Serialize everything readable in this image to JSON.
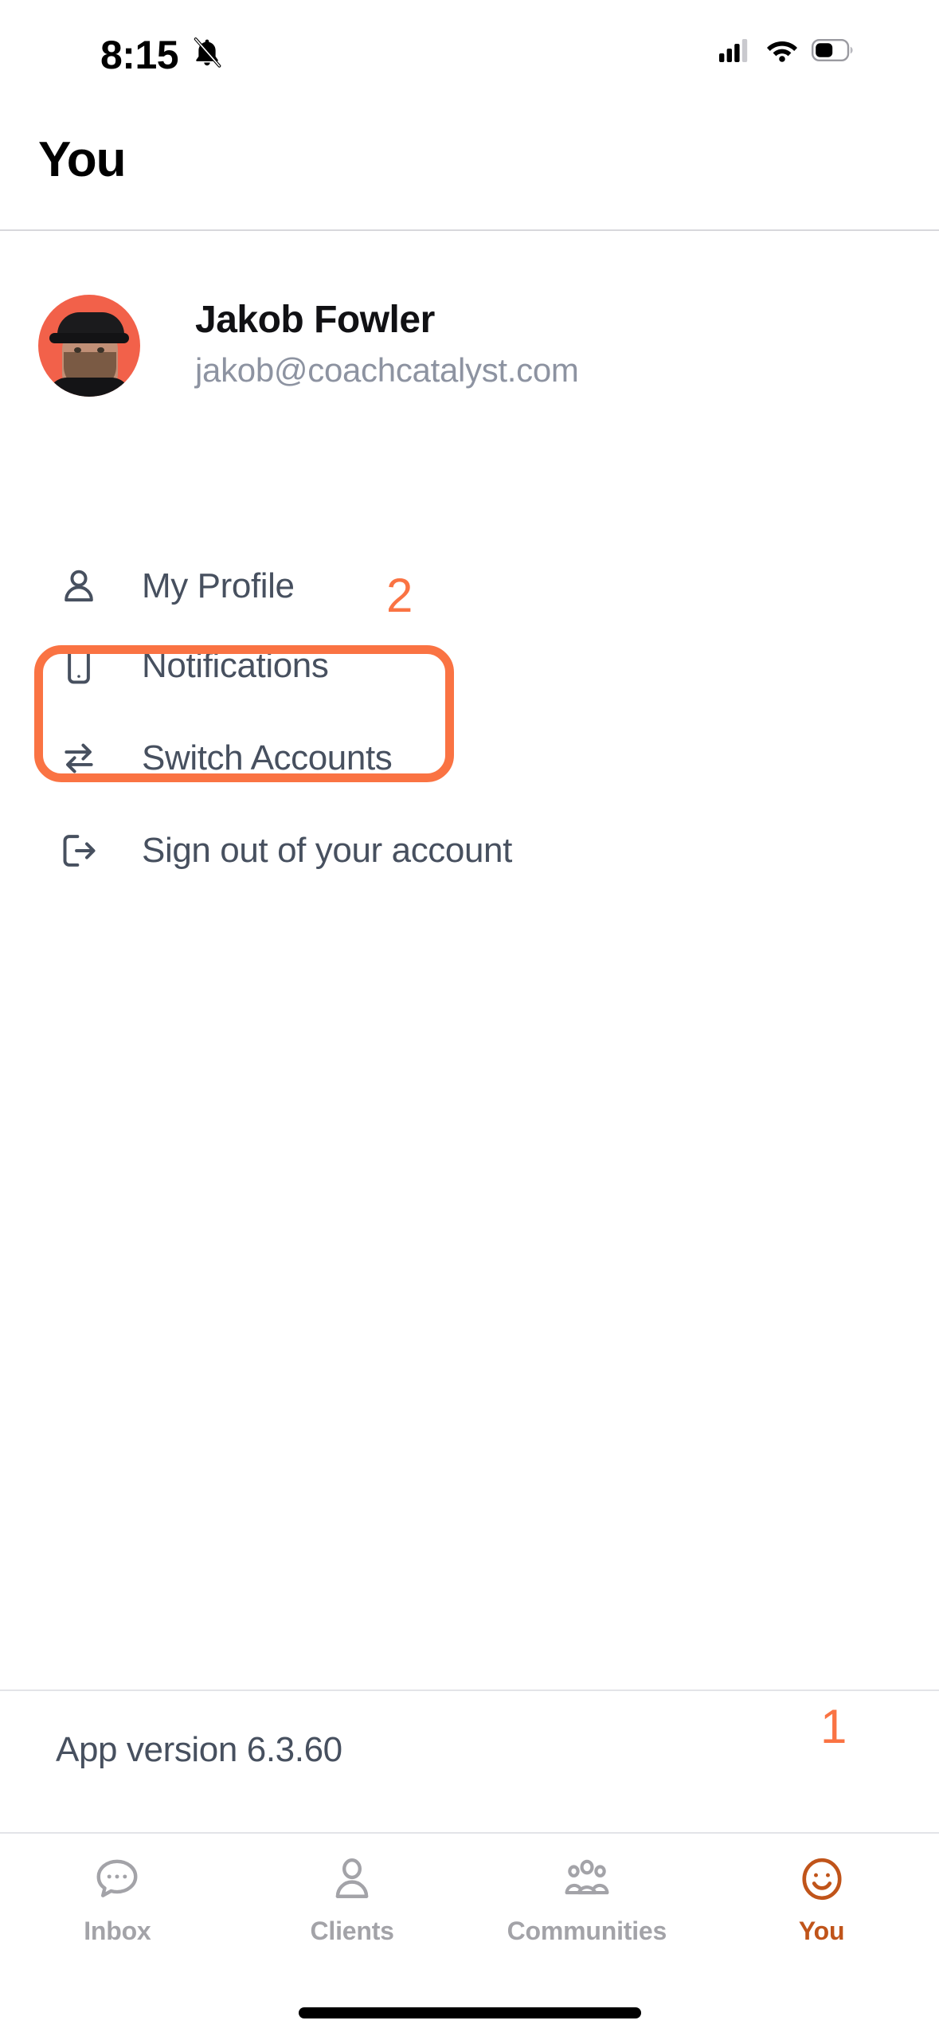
{
  "status_bar": {
    "time": "8:15",
    "mute_icon": "bell-slash-icon",
    "cellular_icon": "cellular-signal-icon",
    "wifi_icon": "wifi-icon",
    "battery_icon": "battery-icon"
  },
  "header": {
    "title": "You"
  },
  "profile": {
    "name": "Jakob Fowler",
    "email": "jakob@coachcatalyst.com",
    "avatar_bg": "#F2614A"
  },
  "menu": {
    "items": [
      {
        "id": "my-profile",
        "label": "My Profile",
        "icon": "person-icon"
      },
      {
        "id": "notifications",
        "label": "Notifications",
        "icon": "mobile-phone-icon"
      },
      {
        "id": "switch",
        "label": "Switch Accounts",
        "icon": "swap-arrows-icon"
      },
      {
        "id": "signout",
        "label": "Sign out of your account",
        "icon": "logout-icon"
      }
    ]
  },
  "annotations": {
    "marker_two": "2",
    "marker_one": "1",
    "color": "#FA7343"
  },
  "footer": {
    "app_version": "App version 6.3.60"
  },
  "tab_bar": {
    "tabs": [
      {
        "id": "inbox",
        "label": "Inbox",
        "icon": "chat-bubble-icon",
        "active": false
      },
      {
        "id": "clients",
        "label": "Clients",
        "icon": "person-icon",
        "active": false
      },
      {
        "id": "communities",
        "label": "Communities",
        "icon": "people-group-icon",
        "active": false
      },
      {
        "id": "you",
        "label": "You",
        "icon": "smiley-face-icon",
        "active": true
      }
    ],
    "active_color": "#C0541A",
    "inactive_color": "#A3A3A8"
  }
}
